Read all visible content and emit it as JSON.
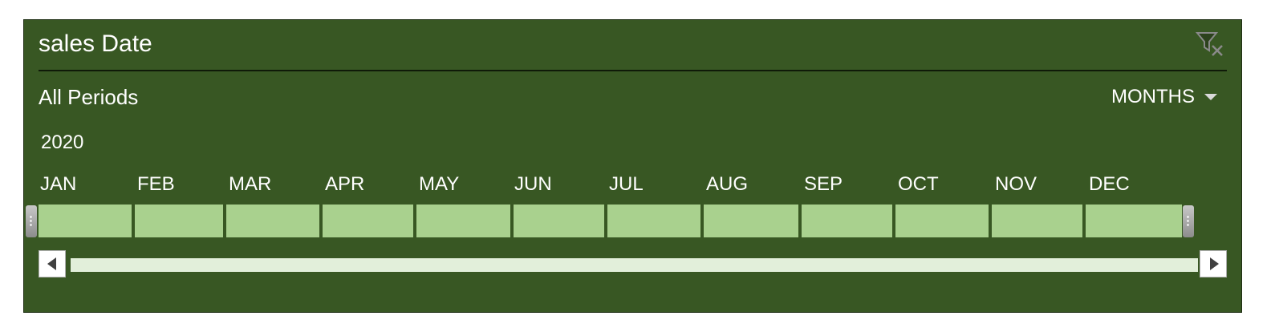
{
  "timeline": {
    "title": "sales Date",
    "selection_label": "All Periods",
    "time_level": "MONTHS",
    "year": "2020",
    "months": [
      "JAN",
      "FEB",
      "MAR",
      "APR",
      "MAY",
      "JUN",
      "JUL",
      "AUG",
      "SEP",
      "OCT",
      "NOV",
      "DEC"
    ],
    "selected_months": 12,
    "colors": {
      "background": "#385723",
      "bar_fill": "#a9d18e",
      "scroll_track": "#e2efda",
      "text": "#ffffff"
    },
    "icons": {
      "clear_filter": "clear-filter-icon",
      "level_dropdown": "caret-down-icon",
      "scroll_left": "scroll-left-arrow-icon",
      "scroll_right": "scroll-right-arrow-icon"
    }
  }
}
